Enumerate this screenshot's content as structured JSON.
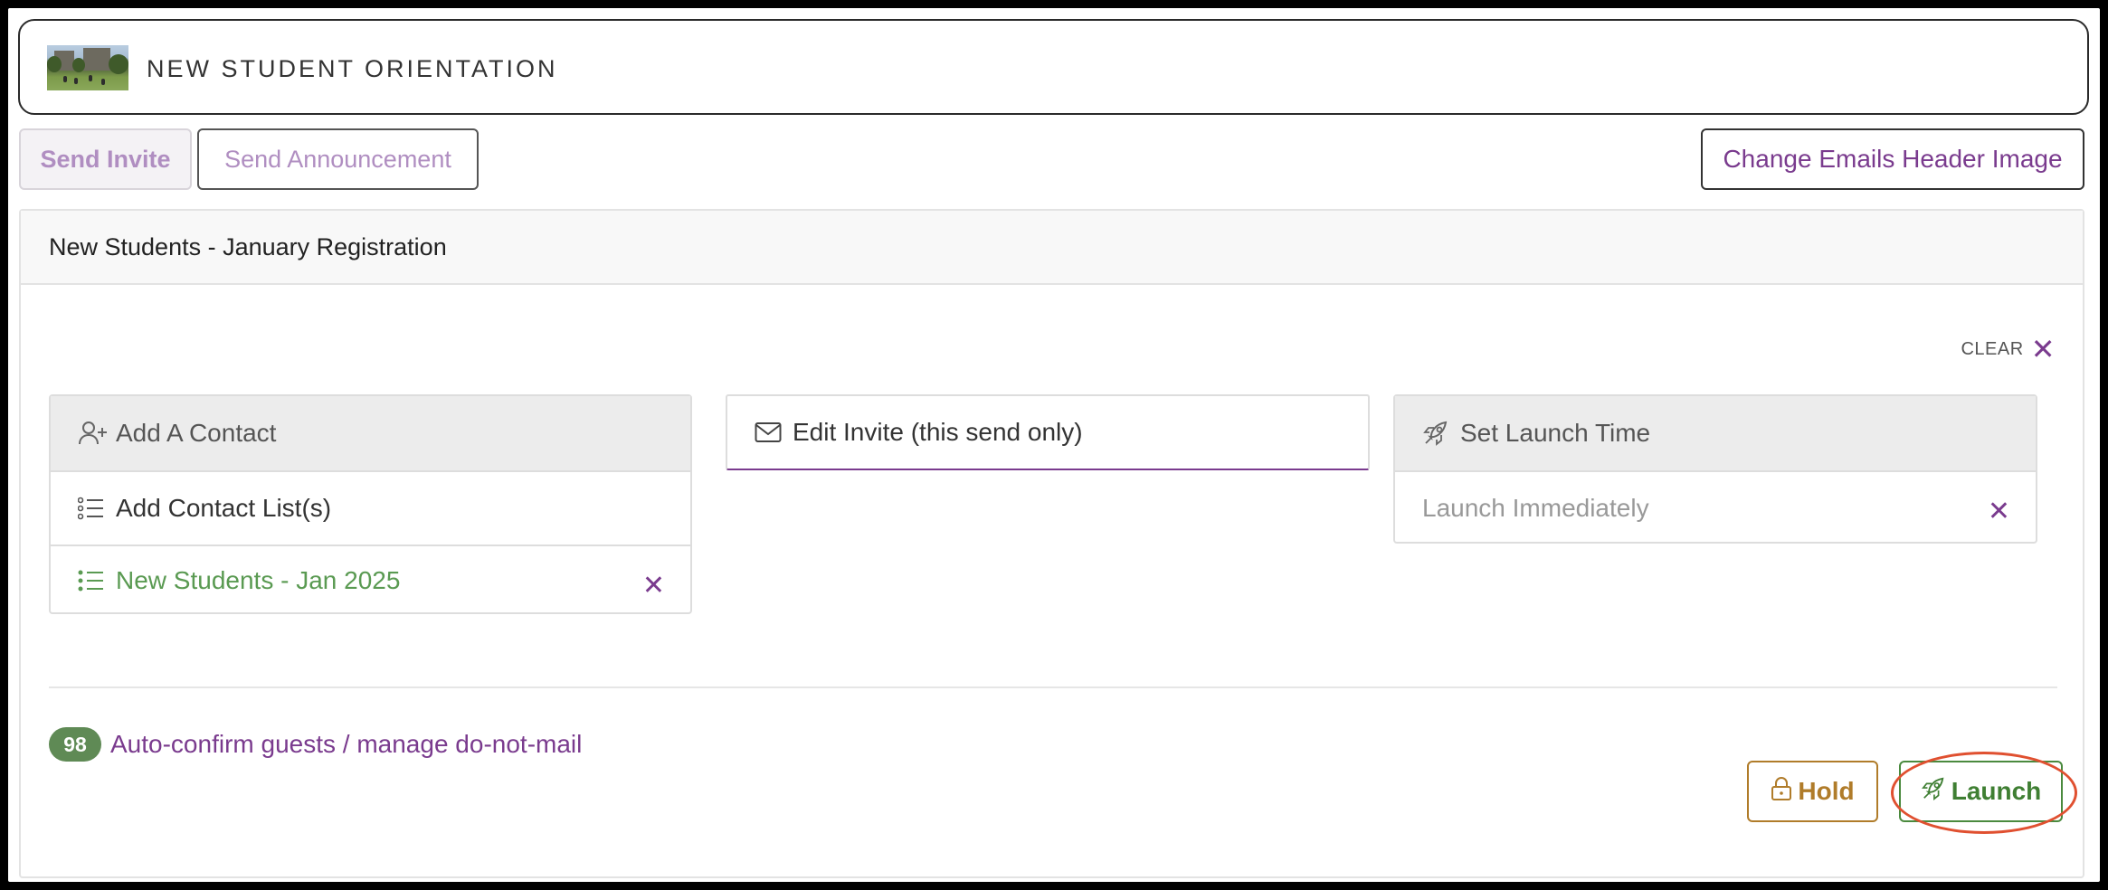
{
  "header": {
    "title": "NEW STUDENT ORIENTATION",
    "thumbnail_icon": "campus-photo"
  },
  "toolbar": {
    "send_invite_label": "Send Invite",
    "send_announcement_label": "Send Announcement",
    "change_header_image_label": "Change Emails Header Image"
  },
  "panel": {
    "title": "New Students - January Registration",
    "clear_label": "CLEAR",
    "contacts": {
      "add_contact_label": "Add A Contact",
      "add_list_label": "Add Contact List(s)",
      "selected_lists": [
        "New Students - Jan 2025"
      ]
    },
    "edit_invite_label": "Edit Invite (this send only)",
    "launch_time": {
      "label": "Set Launch Time",
      "value": "Launch Immediately"
    },
    "auto_confirm": {
      "count": "98",
      "label": "Auto-confirm guests / manage do-not-mail"
    },
    "hold_label": "Hold",
    "launch_label": "Launch"
  },
  "colors": {
    "accent_purple": "#7a3b8e",
    "list_green": "#5a9a52",
    "hold_gold": "#b07c2a",
    "launch_green": "#3f7f33",
    "highlight_red": "#e05030"
  }
}
